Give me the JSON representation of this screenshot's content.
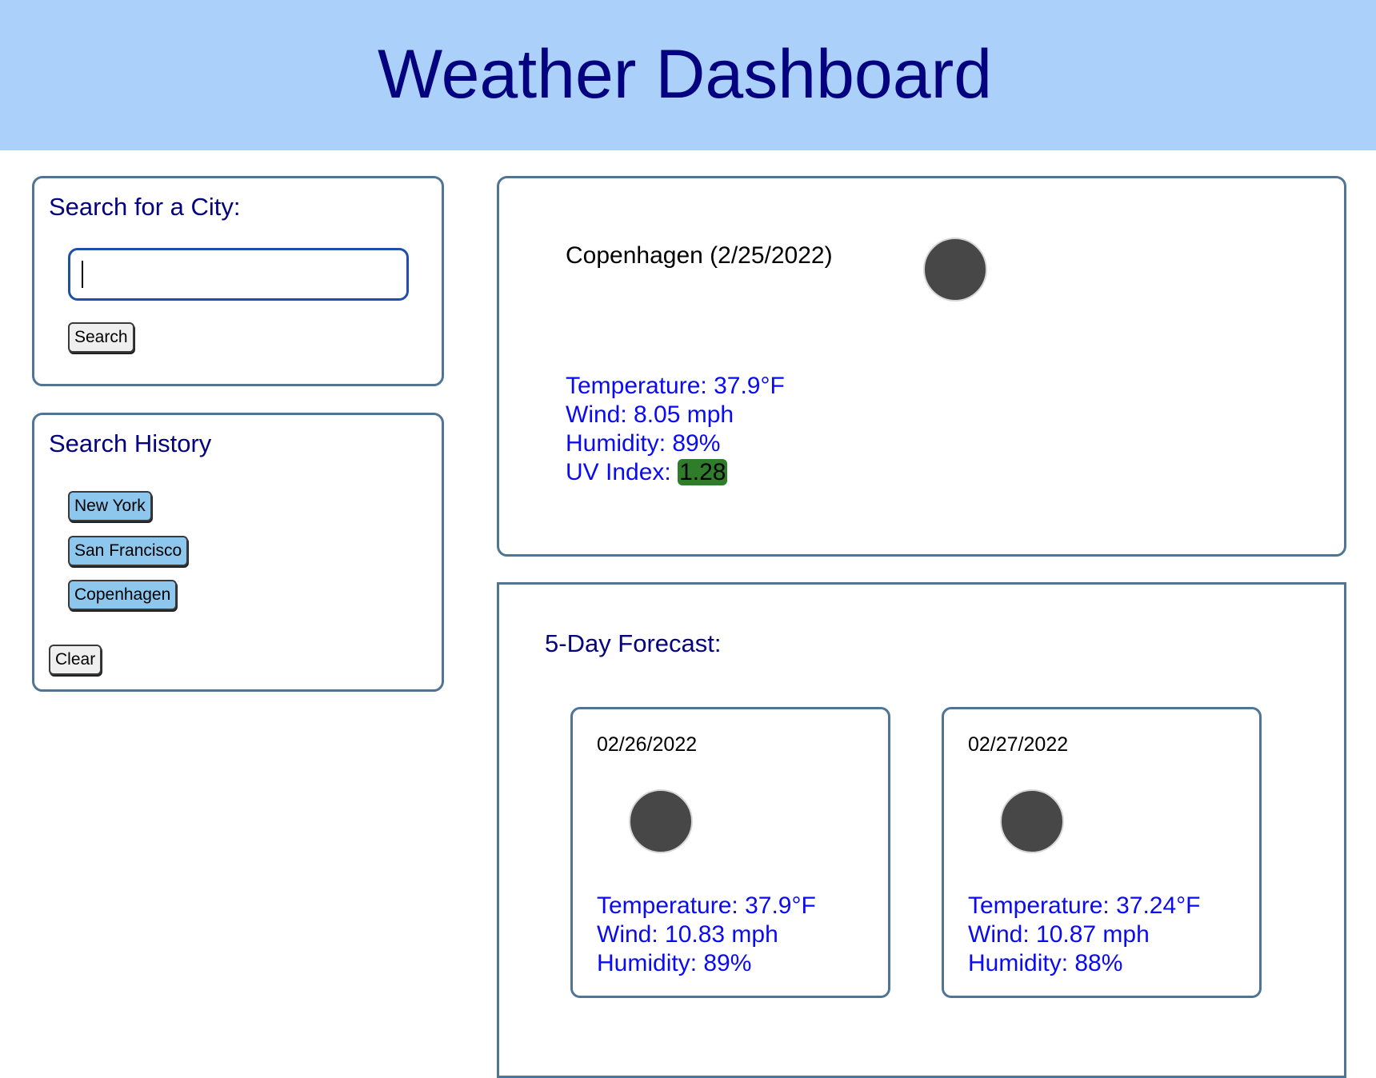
{
  "header": {
    "title": "Weather Dashboard"
  },
  "search": {
    "title": "Search for a City:",
    "input_value": "",
    "button_label": "Search"
  },
  "history": {
    "title": "Search History",
    "items": [
      {
        "label": "New York"
      },
      {
        "label": "San Francisco"
      },
      {
        "label": "Copenhagen"
      }
    ],
    "clear_label": "Clear"
  },
  "current": {
    "city_date": "Copenhagen (2/25/2022)",
    "icon": "weather-icon",
    "temperature": "Temperature: 37.9°F",
    "wind": "Wind: 8.05 mph",
    "humidity": "Humidity: 89%",
    "uv_label": "UV Index: ",
    "uv_value": "1.28",
    "uv_color": "#2f7d2a"
  },
  "forecast": {
    "title": "5-Day Forecast:",
    "days": [
      {
        "date": "02/26/2022",
        "icon": "weather-icon",
        "temperature": "Temperature: 37.9°F",
        "wind": "Wind: 10.83 mph",
        "humidity": "Humidity: 89%"
      },
      {
        "date": "02/27/2022",
        "icon": "weather-icon",
        "temperature": "Temperature: 37.24°F",
        "wind": "Wind: 10.87 mph",
        "humidity": "Humidity: 88%"
      }
    ]
  },
  "colors": {
    "header_bg": "#abd0fa",
    "title_text": "#04027e",
    "stat_text": "#0b0bf0",
    "border": "#4f7494",
    "history_button": "#8ec7ee"
  }
}
